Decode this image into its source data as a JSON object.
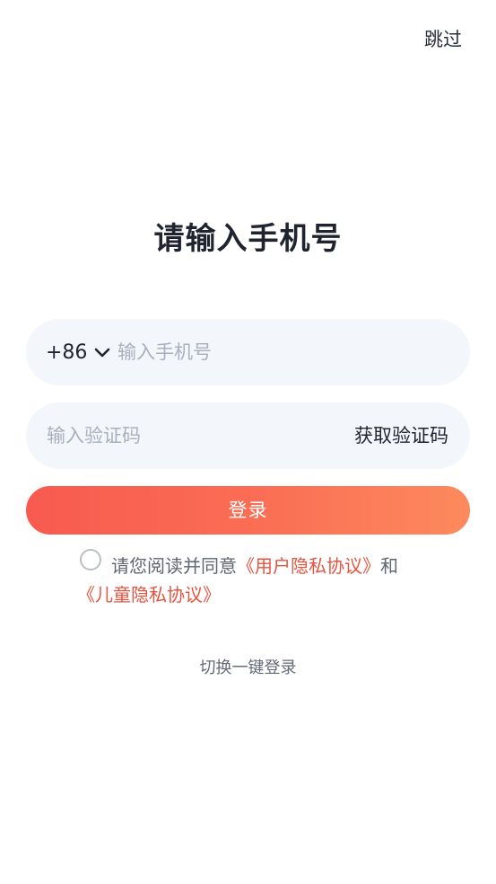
{
  "header": {
    "skip_label": "跳过"
  },
  "title": "请输入手机号",
  "phone": {
    "country_code": "+86",
    "placeholder": "输入手机号",
    "value": ""
  },
  "code": {
    "placeholder": "输入验证码",
    "value": "",
    "get_code_label": "获取验证码"
  },
  "login_label": "登录",
  "agreement": {
    "checked": false,
    "prefix": "请您阅读并同意",
    "user_privacy_link": "《用户隐私协议》",
    "conjunction": "和",
    "child_privacy_link": "《儿童隐私协议》"
  },
  "switch_label": "切换一键登录",
  "colors": {
    "accent": "#e8533f",
    "button_start": "#f85a4f",
    "button_end": "#fd8a5d",
    "field_bg": "#f3f6fb"
  },
  "icons": {
    "country_dropdown": "chevron-down-icon"
  }
}
